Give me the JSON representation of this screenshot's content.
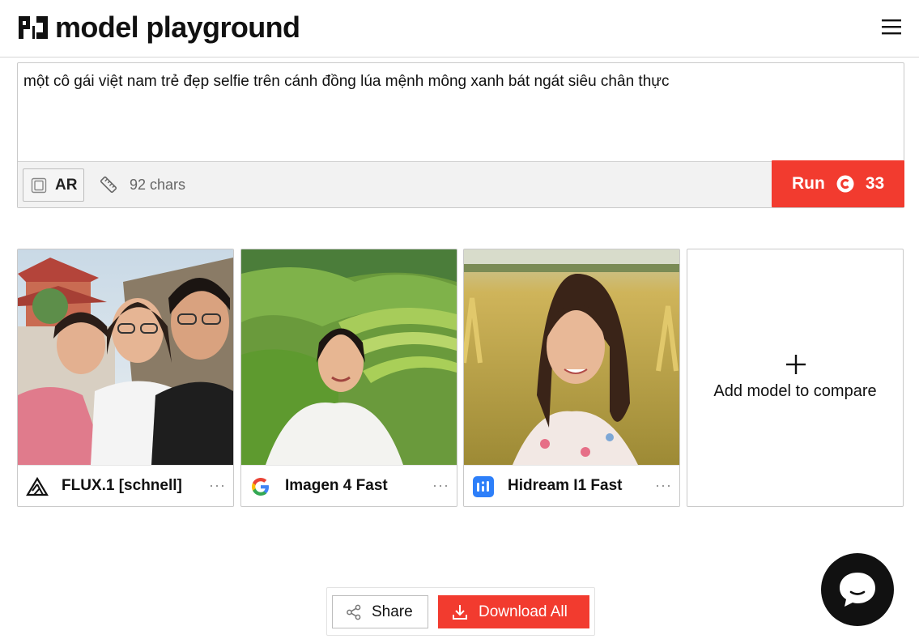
{
  "app": {
    "logo_text": "model playground"
  },
  "prompt": {
    "text": "một cô gái việt nam trẻ đẹp selfie trên cánh đồng lúa mệnh mông xanh bát ngát siêu chân thực",
    "ar_label": "AR",
    "char_count": "92 chars",
    "run_label": "Run",
    "run_cost": "33"
  },
  "cards": [
    {
      "model": "FLUX.1 [schnell]",
      "icon": "flux-icon",
      "more": "···"
    },
    {
      "model": "Imagen 4 Fast",
      "icon": "google-icon",
      "more": "···"
    },
    {
      "model": "Hidream I1 Fast",
      "icon": "hidream-icon",
      "more": "···"
    }
  ],
  "add_card": {
    "label": "Add model to compare"
  },
  "actions": {
    "share_label": "Share",
    "download_label": "Download All"
  },
  "colors": {
    "accent": "#f23b2f",
    "text": "#111111",
    "border": "#c9c9c9"
  }
}
